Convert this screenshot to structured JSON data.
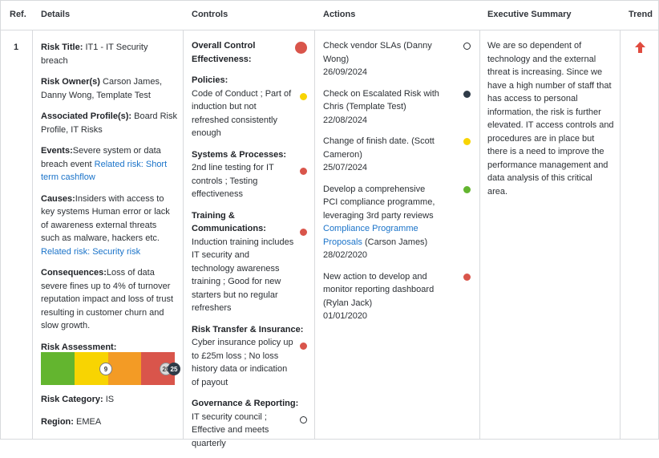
{
  "headers": {
    "ref": "Ref.",
    "details": "Details",
    "controls": "Controls",
    "actions": "Actions",
    "summary": "Executive Summary",
    "trend": "Trend"
  },
  "row": {
    "ref": "1",
    "details": {
      "risk_title_label": "Risk Title:",
      "risk_title": "IT1 - IT Security breach",
      "risk_owners_label": "Risk Owner(s)",
      "risk_owners": "Carson James, Danny Wong, Template Test",
      "profiles_label": "Associated Profile(s):",
      "profiles": "Board Risk Profile, IT Risks",
      "events_label": "Events:",
      "events": "Severe system or data breach event",
      "events_link": "Related risk: Short term cashflow",
      "causes_label": "Causes:",
      "causes": "Insiders with access to key systems Human error or lack of awareness external threats such as malware, hackers etc.",
      "causes_link": "Related risk: Security risk",
      "consequences_label": "Consequences:",
      "consequences": "Loss of data severe fines up to 4% of turnover reputation impact and loss of trust resulting in customer churn and slow growth.",
      "assessment_label": "Risk Assessment:",
      "assessment": {
        "band_colors": [
          "#63b52f",
          "#f8d402",
          "#f39b25",
          "#d9554b"
        ],
        "target_score": "9",
        "inherent_score": "20",
        "current_score": "25"
      },
      "category_label": "Risk Category:",
      "category": "IS",
      "region_label": "Region:",
      "region": "EMEA"
    },
    "controls": {
      "overall_label": "Overall Control Effectiveness:",
      "overall_color": "#d9554b",
      "items": [
        {
          "heading": "Policies:",
          "text": "Code of Conduct ; Part of induction but not refreshed consistently enough",
          "status_color": "#f8d402"
        },
        {
          "heading": "Systems & Processes:",
          "text": "2nd line testing for IT controls ; Testing effectiveness",
          "status_color": "#d9554b"
        },
        {
          "heading": "Training & Communications:",
          "text": "Induction training includes IT security and technology awareness training ; Good for new starters but no regular refreshers",
          "status_color": "#d9554b"
        },
        {
          "heading": "Risk Transfer & Insurance:",
          "text": "Cyber insurance policy up to £25m loss ; No loss history data or indication of payout",
          "status_color": "#d9554b"
        },
        {
          "heading": "Governance & Reporting:",
          "text": "IT security council ; Effective and meets quarterly",
          "status_color": "none"
        }
      ]
    },
    "actions": [
      {
        "text": "Check vendor SLAs (Danny Wong)",
        "date": "26/09/2024",
        "status_color": "none"
      },
      {
        "text": "Check on Escalated Risk with Chris (Template Test)",
        "date": "22/08/2024",
        "status_color": "#2f3b48"
      },
      {
        "text": "Change of finish date.  (Scott Cameron)",
        "date": "25/07/2024",
        "status_color": "#f8d402"
      },
      {
        "text_before": "Develop a comprehensive PCI compliance programme, leveraging 3rd party reviews",
        "link": "Compliance Programme Proposals",
        "text_after": "(Carson James)",
        "date": "28/02/2020",
        "status_color": "#63b52f"
      },
      {
        "text": "New action to develop and monitor reporting dashboard (Rylan Jack)",
        "date": "01/01/2020",
        "status_color": "#d9554b"
      }
    ],
    "summary": "We are so dependent of technology and the external threat is increasing. Since we have a high number of staff that has access to personal information, the risk is further elevated. IT access controls and procedures are in place but there is a need to improve the performance management and data analysis of this critical area.",
    "trend": {
      "icon": "arrow-up-icon",
      "color": "#e04b3f"
    }
  }
}
